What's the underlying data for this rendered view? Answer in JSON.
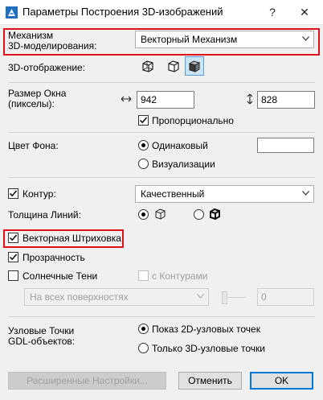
{
  "window": {
    "title": "Параметры Построения 3D-изображений",
    "help_label": "?",
    "close_label": "✕",
    "icon": "archicad-app-icon"
  },
  "engine": {
    "label": "Механизм\n3D-моделирования:",
    "value": "Векторный Механизм"
  },
  "display": {
    "label": "3D-отображение:",
    "icons": [
      "wireframe-box-icon",
      "hidden-line-box-icon",
      "shaded-box-icon"
    ],
    "selected_index": 2
  },
  "window_size": {
    "label": "Размер Окна\n(пикселы):",
    "width": "942",
    "height": "828",
    "proportional_label": "Пропорционально",
    "proportional_checked": true
  },
  "background": {
    "label": "Цвет Фона:",
    "option_same": "Одинаковый",
    "option_render": "Визуализации",
    "selected": "same"
  },
  "contour": {
    "label": "Контур:",
    "checked": true,
    "value": "Качественный"
  },
  "line_weight": {
    "label": "Толщина Линий:",
    "selected": 0
  },
  "vector_hatching": {
    "label": "Векторная Штриховка",
    "checked": true
  },
  "transparency": {
    "label": "Прозрачность",
    "checked": true
  },
  "sun_shadows": {
    "label": "Солнечные Тени",
    "checked": false,
    "with_contours_label": "с Контурами",
    "surfaces_value": "На всех поверхностях",
    "amount_value": "0"
  },
  "gdl_nodes": {
    "label": "Узловые Точки\nGDL-объектов:",
    "option_2d": "Показ 2D-узловых точек",
    "option_3d": "Только 3D-узловые точки",
    "selected": "2d"
  },
  "buttons": {
    "advanced": "Расширенные Настройки...",
    "cancel": "Отменить",
    "ok": "OK"
  },
  "colors": {
    "highlight": "#e0101a",
    "panel": "#f0f0f0",
    "accent": "#0078d7"
  }
}
